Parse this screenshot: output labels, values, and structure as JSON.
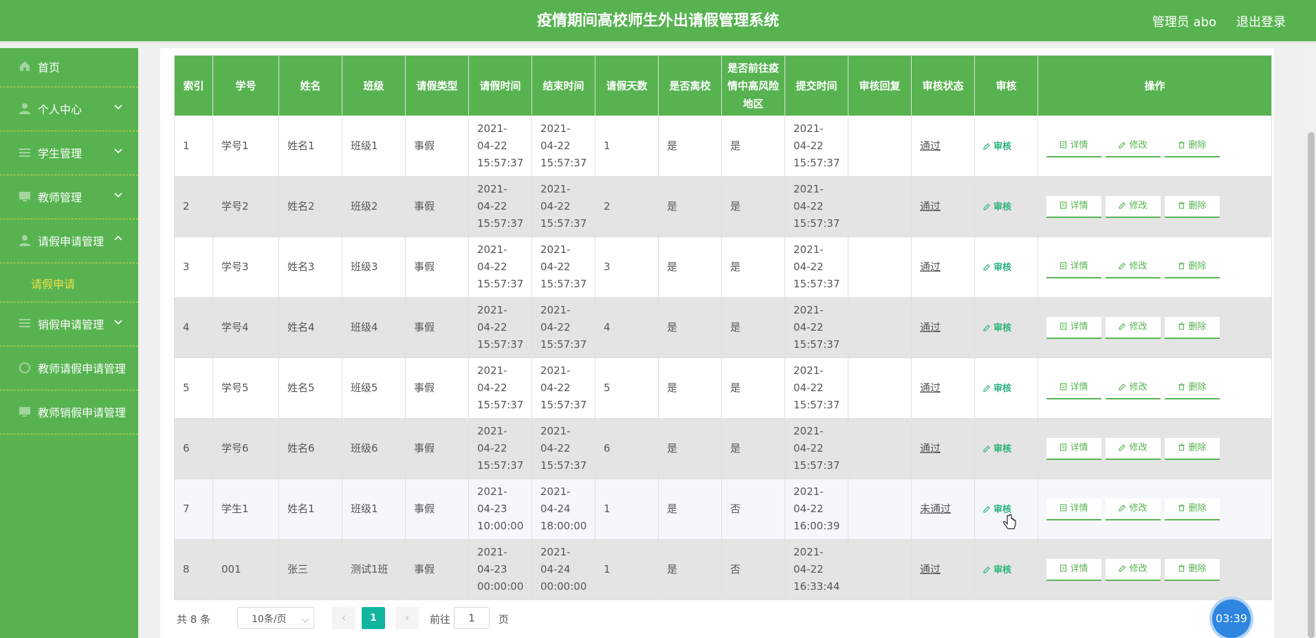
{
  "header": {
    "title": "疫情期间高校师生外出请假管理系统",
    "user": "管理员 abo",
    "logout": "退出登录"
  },
  "sidebar": {
    "items": [
      {
        "label": "首页",
        "icon": "home-icon",
        "chevron": ""
      },
      {
        "label": "个人中心",
        "icon": "person-icon",
        "chevron": "down"
      },
      {
        "label": "学生管理",
        "icon": "grid-icon",
        "chevron": "down"
      },
      {
        "label": "教师管理",
        "icon": "monitor-icon",
        "chevron": "down"
      },
      {
        "label": "请假申请管理",
        "icon": "person-icon",
        "chevron": "up"
      },
      {
        "label": "销假申请管理",
        "icon": "list-icon",
        "chevron": "down"
      },
      {
        "label": "教师请假申请管理",
        "icon": "circle-icon",
        "chevron": ""
      },
      {
        "label": "教师销假申请管理",
        "icon": "monitor-icon",
        "chevron": ""
      }
    ],
    "submenu": {
      "label": "请假申请"
    }
  },
  "table": {
    "headers": [
      "索引",
      "学号",
      "姓名",
      "班级",
      "请假类型",
      "请假时间",
      "结束时间",
      "请假天数",
      "是否离校",
      "是否前往疫情中高风险地区",
      "提交时间",
      "审核回复",
      "审核状态",
      "审核",
      "操作"
    ],
    "review_label": "审核",
    "op_labels": {
      "detail": "详情",
      "edit": "修改",
      "delete": "删除"
    },
    "rows": [
      {
        "idx": "1",
        "sid": "学号1",
        "name": "姓名1",
        "cls": "班级1",
        "type": "事假",
        "start": "2021-04-22 15:57:37",
        "end": "2021-04-22 15:57:37",
        "days": "1",
        "left": "是",
        "risk": "是",
        "submit": "2021-04-22 15:57:37",
        "reply": "",
        "status": "通过"
      },
      {
        "idx": "2",
        "sid": "学号2",
        "name": "姓名2",
        "cls": "班级2",
        "type": "事假",
        "start": "2021-04-22 15:57:37",
        "end": "2021-04-22 15:57:37",
        "days": "2",
        "left": "是",
        "risk": "是",
        "submit": "2021-04-22 15:57:37",
        "reply": "",
        "status": "通过"
      },
      {
        "idx": "3",
        "sid": "学号3",
        "name": "姓名3",
        "cls": "班级3",
        "type": "事假",
        "start": "2021-04-22 15:57:37",
        "end": "2021-04-22 15:57:37",
        "days": "3",
        "left": "是",
        "risk": "是",
        "submit": "2021-04-22 15:57:37",
        "reply": "",
        "status": "通过"
      },
      {
        "idx": "4",
        "sid": "学号4",
        "name": "姓名4",
        "cls": "班级4",
        "type": "事假",
        "start": "2021-04-22 15:57:37",
        "end": "2021-04-22 15:57:37",
        "days": "4",
        "left": "是",
        "risk": "是",
        "submit": "2021-04-22 15:57:37",
        "reply": "",
        "status": "通过"
      },
      {
        "idx": "5",
        "sid": "学号5",
        "name": "姓名5",
        "cls": "班级5",
        "type": "事假",
        "start": "2021-04-22 15:57:37",
        "end": "2021-04-22 15:57:37",
        "days": "5",
        "left": "是",
        "risk": "是",
        "submit": "2021-04-22 15:57:37",
        "reply": "",
        "status": "通过"
      },
      {
        "idx": "6",
        "sid": "学号6",
        "name": "姓名6",
        "cls": "班级6",
        "type": "事假",
        "start": "2021-04-22 15:57:37",
        "end": "2021-04-22 15:57:37",
        "days": "6",
        "left": "是",
        "risk": "是",
        "submit": "2021-04-22 15:57:37",
        "reply": "",
        "status": "通过"
      },
      {
        "idx": "7",
        "sid": "学生1",
        "name": "姓名1",
        "cls": "班级1",
        "type": "事假",
        "start": "2021-04-23 10:00:00",
        "end": "2021-04-24 18:00:00",
        "days": "1",
        "left": "是",
        "risk": "否",
        "submit": "2021-04-22 16:00:39",
        "reply": "",
        "status": "未通过"
      },
      {
        "idx": "8",
        "sid": "001",
        "name": "张三",
        "cls": "测试1班",
        "type": "事假",
        "start": "2021-04-23 00:00:00",
        "end": "2021-04-24 00:00:00",
        "days": "1",
        "left": "是",
        "risk": "否",
        "submit": "2021-04-22 16:33:44",
        "reply": "",
        "status": "通过"
      }
    ]
  },
  "pagination": {
    "total": "共 8 条",
    "page_size": "10条/页",
    "current_page": "1",
    "goto_prefix": "前往",
    "goto_value": "1",
    "goto_suffix": "页"
  },
  "clock": "03:39",
  "colors": {
    "primary": "#57b350",
    "accent_text": "#f0e14a",
    "page_active": "#11b59d",
    "link": "#2ab27b"
  }
}
